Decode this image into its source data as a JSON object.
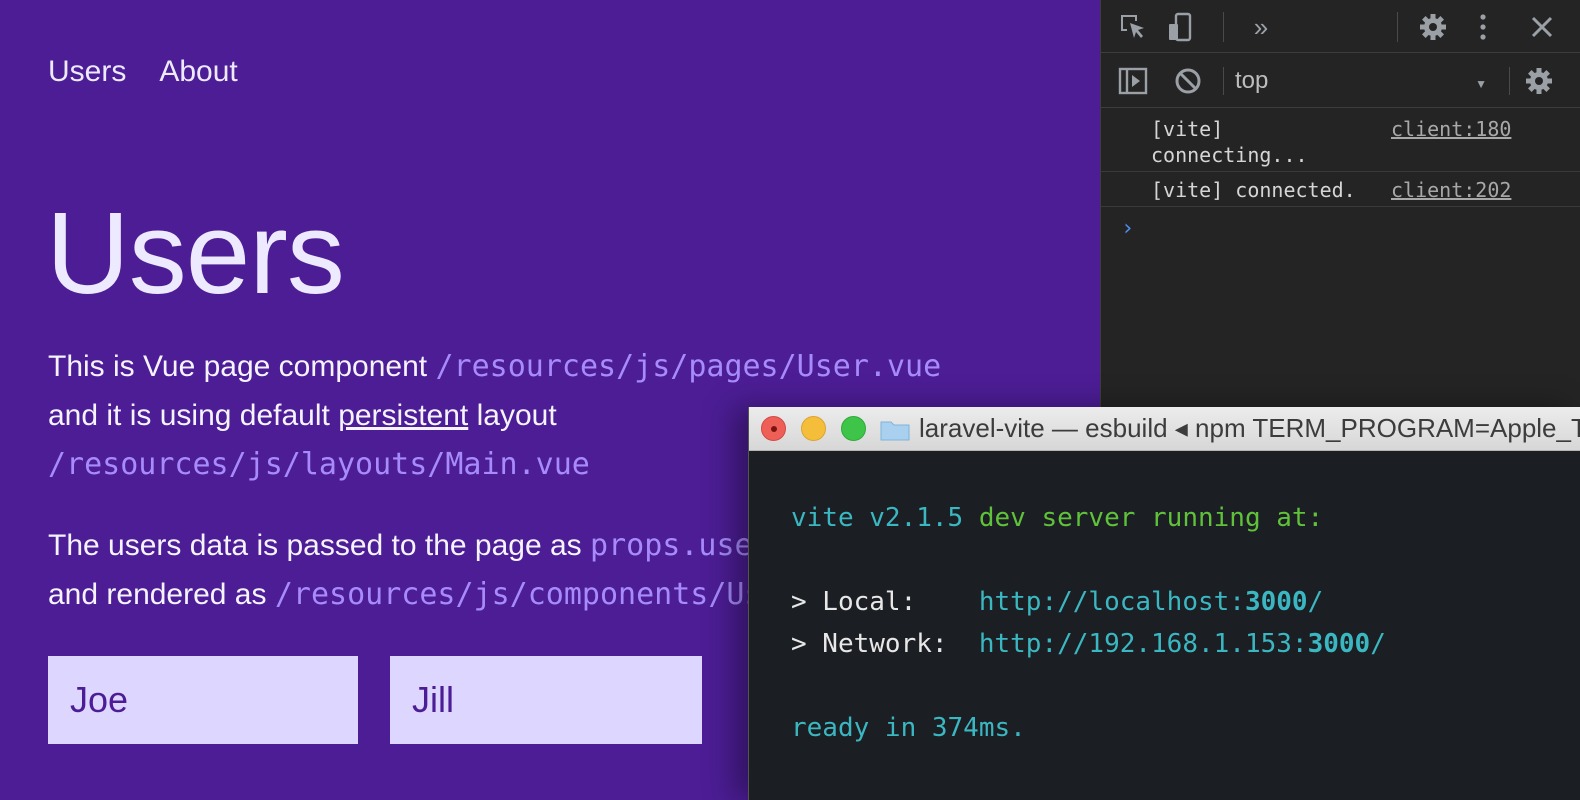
{
  "nav": {
    "items": [
      "Users",
      "About"
    ]
  },
  "page": {
    "title": "Users",
    "p1": {
      "t1": "This is Vue page component ",
      "c1": "/resources/js/pages/User.vue",
      "t2": "and it is using default ",
      "link": "persistent",
      "t3": " layout",
      "c2": "/resources/js/layouts/Main.vue"
    },
    "p2": {
      "t1": "The users data is passed to the page as ",
      "c1": "props.users",
      "t2": "and rendered as ",
      "c2": "/resources/js/components/User.vue"
    },
    "cards": [
      "Joe",
      "Jill"
    ]
  },
  "devtools": {
    "context": "top",
    "logs": [
      {
        "line1": "[vite]",
        "line2": "connecting...",
        "source": "client:180"
      },
      {
        "line1": "[vite] connected.",
        "source": "client:202"
      }
    ],
    "prompt": "›",
    "colors": {
      "background": "#242424",
      "prompt": "#4d8ef0"
    }
  },
  "terminal": {
    "title": "laravel-vite — esbuild ◂ npm TERM_PROGRAM=Apple_Terminal",
    "lines": {
      "vite_version": "vite v2.1.5",
      "running": " dev server running at:",
      "local_label": "> Local:    ",
      "local_url_pre": "http://localhost:",
      "local_port": "3000",
      "local_url_post": "/",
      "network_label": "> Network:  ",
      "network_url_pre": "http://192.168.1.153:",
      "network_port": "3000",
      "network_url_post": "/",
      "ready": "ready in 374ms."
    },
    "colors": {
      "background": "#1b1e23",
      "cyan": "#3bb7c2",
      "green": "#5fc23a"
    }
  },
  "app_colors": {
    "background": "#4c1d95",
    "code": "#a78bfa",
    "card": "#ddd6fe"
  }
}
